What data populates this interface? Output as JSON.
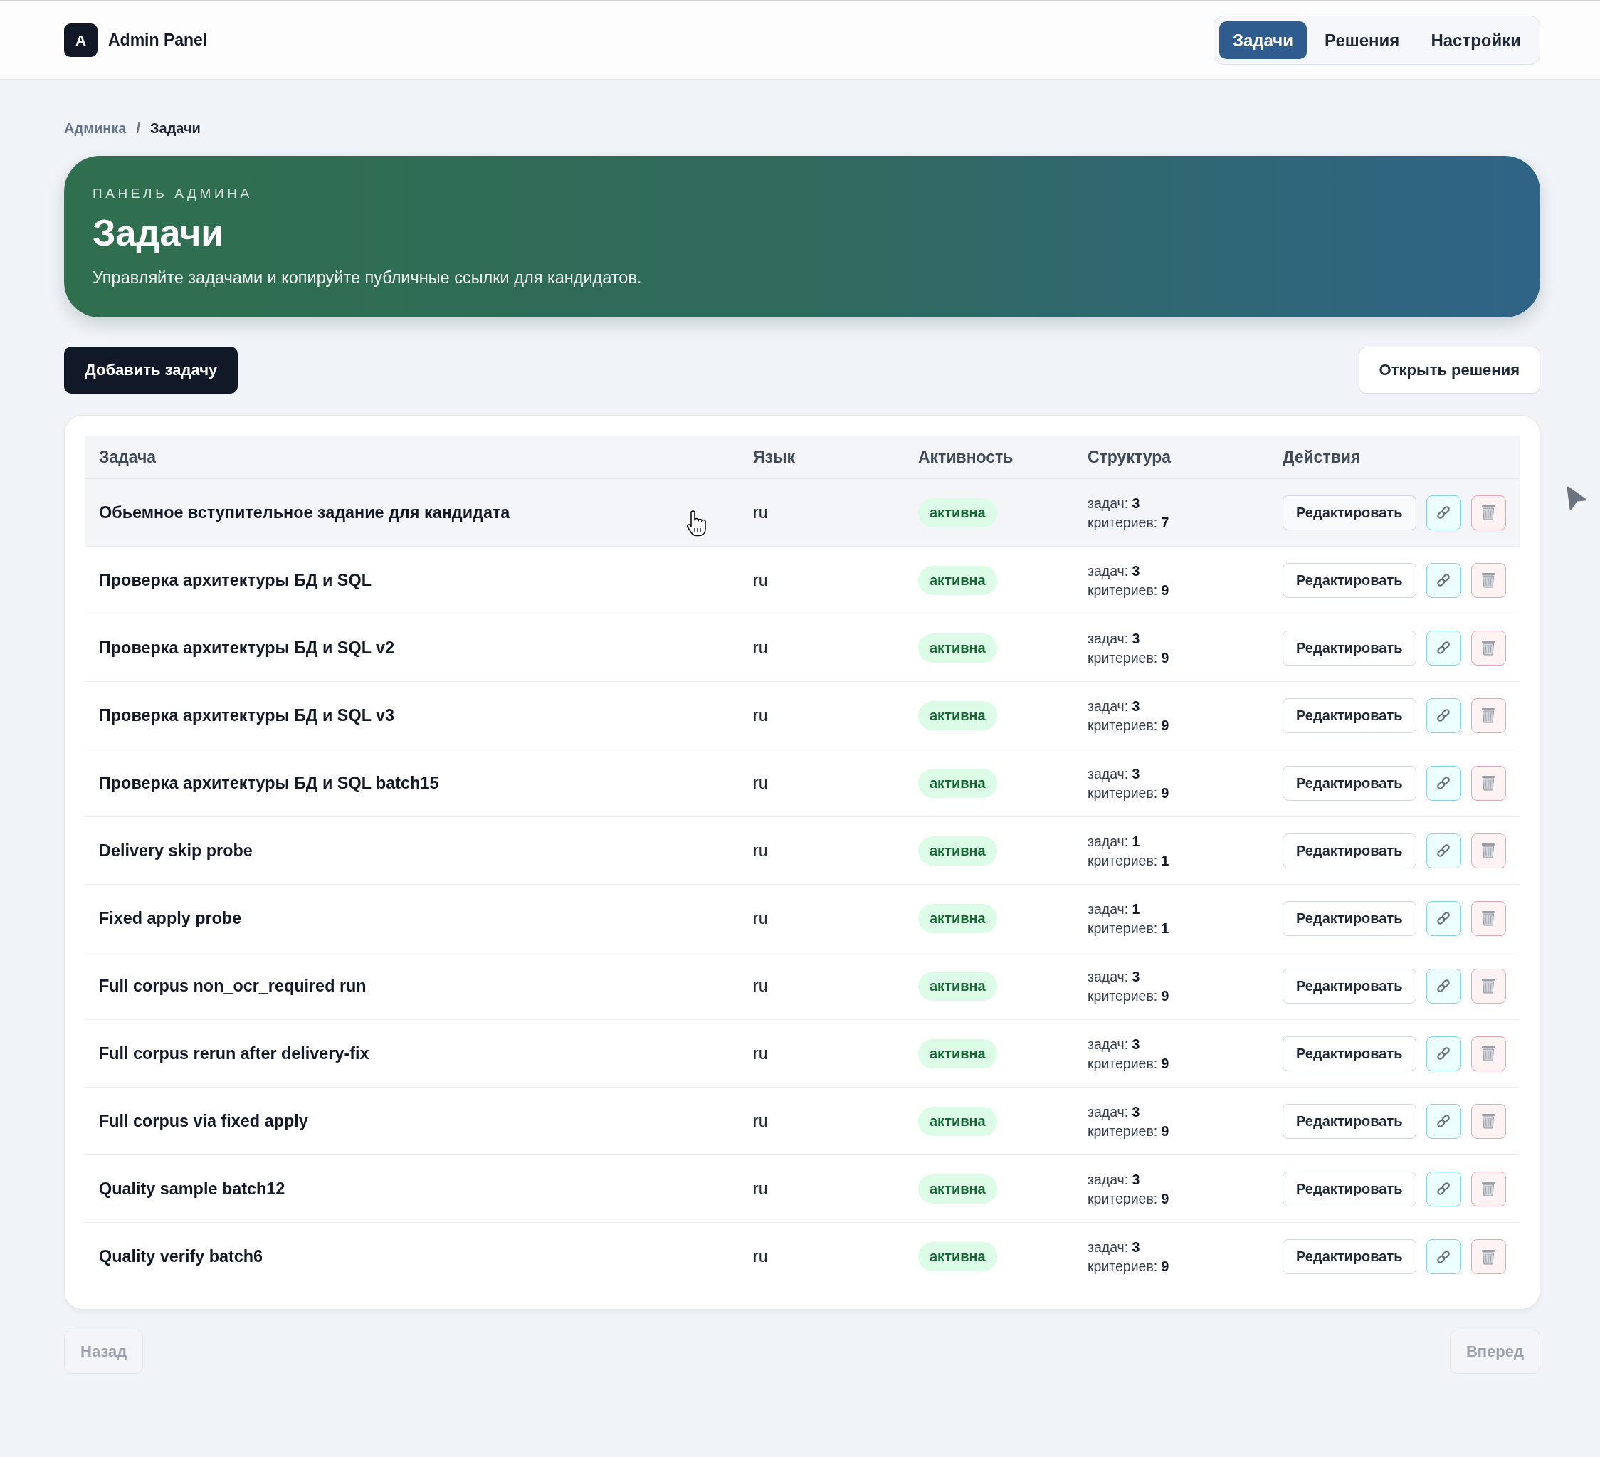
{
  "header": {
    "logo_letter": "A",
    "brand": "Admin Panel",
    "nav": [
      {
        "label": "Задачи",
        "selected": true
      },
      {
        "label": "Решения",
        "selected": false
      },
      {
        "label": "Настройки",
        "selected": false
      }
    ]
  },
  "breadcrumb": {
    "separator": "/",
    "items": [
      {
        "label": "Админка",
        "current": false
      },
      {
        "label": "Задачи",
        "current": true
      }
    ]
  },
  "hero": {
    "eyebrow": "ПАНЕЛЬ АДМИНА",
    "title": "Задачи",
    "subtitle": "Управляйте задачами и копируйте публичные ссылки для кандидатов."
  },
  "toolbar": {
    "primary_button": "Добавить задачу",
    "secondary_button": "Открыть решения"
  },
  "table": {
    "columns": [
      "Задача",
      "Язык",
      "Активность",
      "Структура",
      "Действия"
    ],
    "rows": [
      {
        "title": "Обьемное вступительное задание для кандидата",
        "language": "ru",
        "status": "активна",
        "active": true,
        "tasks": "задач: **3**",
        "criteria": "критериев: **7**",
        "edit_label": "Редактировать",
        "hovered": true
      },
      {
        "title": "Проверка архитектуры БД и SQL",
        "language": "ru",
        "status": "активна",
        "active": true,
        "tasks": "задач: **3**",
        "criteria": "критериев: **9**",
        "edit_label": "Редактировать",
        "hovered": false
      },
      {
        "title": "Проверка архитектуры БД и SQL v2",
        "language": "ru",
        "status": "активна",
        "active": true,
        "tasks": "задач: **3**",
        "criteria": "критериев: **9**",
        "edit_label": "Редактировать",
        "hovered": false
      },
      {
        "title": "Проверка архитектуры БД и SQL v3",
        "language": "ru",
        "status": "активна",
        "active": true,
        "tasks": "задач: **3**",
        "criteria": "критериев: **9**",
        "edit_label": "Редактировать",
        "hovered": false
      },
      {
        "title": "Проверка архитектуры БД и SQL batch15",
        "language": "ru",
        "status": "активна",
        "active": true,
        "tasks": "задач: **3**",
        "criteria": "критериев: **9**",
        "edit_label": "Редактировать",
        "hovered": false
      },
      {
        "title": "Delivery skip probe",
        "language": "ru",
        "status": "активна",
        "active": true,
        "tasks": "задач: **1**",
        "criteria": "критериев: **1**",
        "edit_label": "Редактировать",
        "hovered": false
      },
      {
        "title": "Fixed apply probe",
        "language": "ru",
        "status": "активна",
        "active": true,
        "tasks": "задач: **1**",
        "criteria": "критериев: **1**",
        "edit_label": "Редактировать",
        "hovered": false
      },
      {
        "title": "Full corpus non_ocr_required run",
        "language": "ru",
        "status": "активна",
        "active": true,
        "tasks": "задач: **3**",
        "criteria": "критериев: **9**",
        "edit_label": "Редактировать",
        "hovered": false
      },
      {
        "title": "Full corpus rerun after delivery-fix",
        "language": "ru",
        "status": "активна",
        "active": true,
        "tasks": "задач: **3**",
        "criteria": "критериев: **9**",
        "edit_label": "Редактировать",
        "hovered": false
      },
      {
        "title": "Full corpus via fixed apply",
        "language": "ru",
        "status": "активна",
        "active": true,
        "tasks": "задач: **3**",
        "criteria": "критериев: **9**",
        "edit_label": "Редактировать",
        "hovered": false
      },
      {
        "title": "Quality sample batch12",
        "language": "ru",
        "status": "активна",
        "active": true,
        "tasks": "задач: **3**",
        "criteria": "критериев: **9**",
        "edit_label": "Редактировать",
        "hovered": false
      },
      {
        "title": "Quality verify batch6",
        "language": "ru",
        "status": "активна",
        "active": true,
        "tasks": "задач: **3**",
        "criteria": "критериев: **9**",
        "edit_label": "Редактировать",
        "hovered": false
      }
    ]
  },
  "pagination": {
    "prev": {
      "label": "Назад",
      "disabled": true
    },
    "next": {
      "label": "Вперед",
      "disabled": true
    }
  }
}
